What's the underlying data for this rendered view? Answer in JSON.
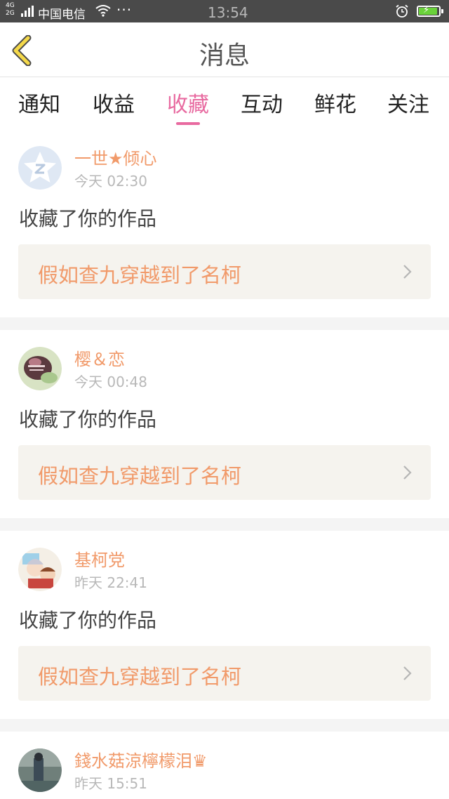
{
  "statusbar": {
    "signal_labels": "4G\n2G",
    "carrier": "中国电信",
    "dots": "···",
    "time": "13:54"
  },
  "header": {
    "title": "消息"
  },
  "tabs": [
    {
      "label": "通知",
      "active": false
    },
    {
      "label": "收益",
      "active": false
    },
    {
      "label": "收藏",
      "active": true
    },
    {
      "label": "互动",
      "active": false
    },
    {
      "label": "鲜花",
      "active": false
    },
    {
      "label": "关注",
      "active": false
    }
  ],
  "colors": {
    "accent_pink": "#e86aa0",
    "name_orange": "#f19a6a",
    "statusbar_bg": "#4a4a4a",
    "back_arrow_yellow": "#f5d94a"
  },
  "messages": [
    {
      "user": "一世★倾心",
      "time": "今天 02:30",
      "action": "收藏了你的作品",
      "work_title": "假如查九穿越到了名柯",
      "avatar": "default-star-avatar"
    },
    {
      "user": "樱＆恋",
      "time": "今天 00:48",
      "action": "收藏了你的作品",
      "work_title": "假如查九穿越到了名柯",
      "avatar": "user-photo-avatar"
    },
    {
      "user": "基柯党",
      "time": "昨天 22:41",
      "action": "收藏了你的作品",
      "work_title": "假如查九穿越到了名柯",
      "avatar": "anime-avatar"
    },
    {
      "user": "錢水菇涼檸檬泪♛",
      "time": "昨天 15:51",
      "action": "",
      "work_title": "",
      "avatar": "photo-avatar"
    }
  ]
}
